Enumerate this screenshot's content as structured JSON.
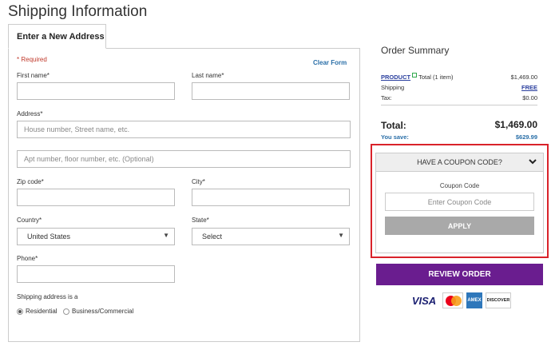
{
  "page": {
    "title": "Shipping Information"
  },
  "form": {
    "tab_label": "Enter a New Address",
    "required_note": "* Required",
    "clear_form": "Clear Form",
    "first_name": {
      "label": "First name*",
      "value": ""
    },
    "last_name": {
      "label": "Last name*",
      "value": ""
    },
    "address": {
      "label": "Address*",
      "placeholder": "House number, Street name, etc."
    },
    "address2": {
      "placeholder": "Apt number, floor number, etc. (Optional)"
    },
    "zip": {
      "label": "Zip code*",
      "value": ""
    },
    "city": {
      "label": "City*",
      "value": ""
    },
    "country": {
      "label": "Country*",
      "selected": "United States"
    },
    "state": {
      "label": "State*",
      "selected": "Select"
    },
    "phone": {
      "label": "Phone*",
      "value": ""
    },
    "address_type": {
      "label": "Shipping address is a",
      "options": [
        "Residential",
        "Business/Commercial"
      ],
      "selected": "Residential"
    }
  },
  "summary": {
    "title": "Order Summary",
    "product_link": "PRODUCT",
    "product_qty": "Total (1 item)",
    "product_price": "$1,469.00",
    "shipping_label": "Shipping",
    "shipping_value": "FREE",
    "tax_label": "Tax:",
    "tax_value": "$0.00",
    "total_label": "Total:",
    "total_value": "$1,469.00",
    "save_label": "You save:",
    "save_value": "$629.99"
  },
  "coupon": {
    "header": "HAVE A COUPON CODE?",
    "label": "Coupon Code",
    "placeholder": "Enter Coupon Code",
    "apply": "APPLY"
  },
  "review_button": "REVIEW ORDER",
  "cards": {
    "visa": "VISA",
    "amex": "AMEX",
    "discover": "DISCOVER"
  },
  "colors": {
    "accent": "#6a1d8f",
    "highlight": "#d9222a",
    "link": "#2a3f9e"
  }
}
